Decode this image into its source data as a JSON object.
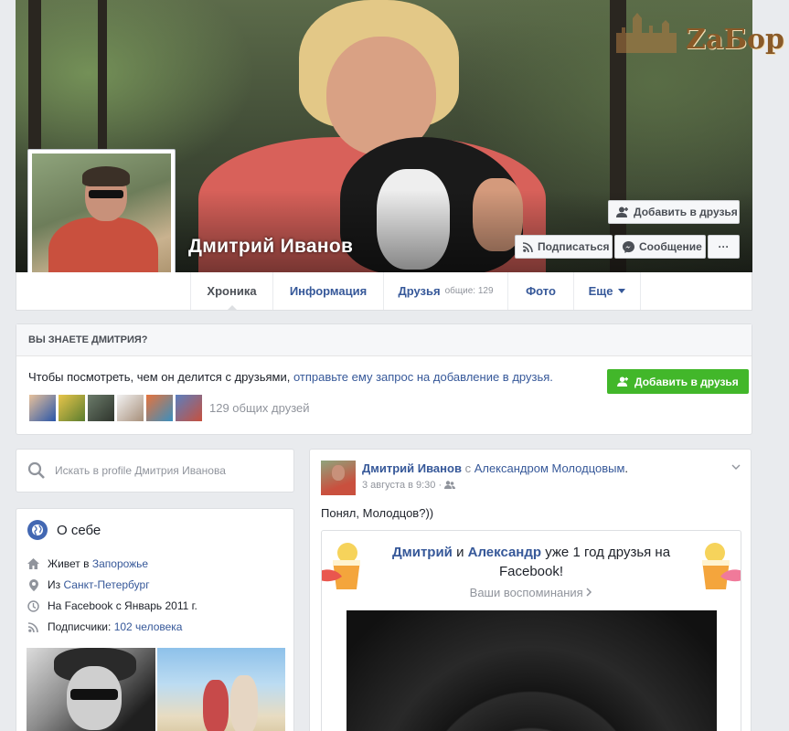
{
  "profile": {
    "name": "Дмитрий Иванов",
    "watermark": "ZаБор"
  },
  "cover_buttons": {
    "add_friend": "Добавить в друзья",
    "subscribe": "Подписаться",
    "message": "Сообщение",
    "more": "···"
  },
  "tabs": [
    {
      "label": "Хроника",
      "active": true
    },
    {
      "label": "Информация"
    },
    {
      "label": "Друзья",
      "sub": "общие: 129"
    },
    {
      "label": "Фото"
    },
    {
      "label": "Еще"
    }
  ],
  "know_card": {
    "header": "ВЫ ЗНАЕТЕ ДМИТРИЯ?",
    "text": "Чтобы посмотреть, чем он делится с друзьями, ",
    "link": "отправьте ему запрос на добавление в друзья.",
    "button": "Добавить в друзья",
    "mutual_count": "129 общих друзей"
  },
  "search": {
    "placeholder": "Искать в profile Дмитрия Иванова"
  },
  "about": {
    "title": "О себе",
    "lives_prefix": "Живет в ",
    "lives_link": "Запорожье",
    "from_prefix": "Из ",
    "from_link": "Санкт-Петербург",
    "since": "На Facebook с Январь 2011 г.",
    "followers_prefix": "Подписчики: ",
    "followers_link": "102 человека"
  },
  "post": {
    "author": "Дмитрий Иванов",
    "with_prefix": " с ",
    "with_name": "Александром Молодцовым",
    "with_suffix": ".",
    "time": "3 августа в 9:30 ·",
    "text": "Понял, Молодцов?))",
    "memory": {
      "name1": "Дмитрий",
      "and": " и ",
      "name2": "Александр",
      "rest": " уже 1 год друзья на",
      "line2": "Facebook!",
      "link": "Ваши воспоминания"
    }
  },
  "colors": {
    "fb_blue": "#365899",
    "green": "#42b72a",
    "bg": "#e9ebee"
  }
}
